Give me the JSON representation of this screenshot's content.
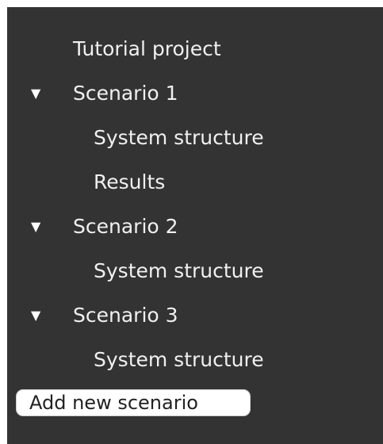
{
  "project": {
    "label": "Tutorial project"
  },
  "scenarios": [
    {
      "label": "Scenario 1",
      "toggle_icon": "▼",
      "children": [
        "System structure",
        "Results"
      ]
    },
    {
      "label": "Scenario 2",
      "toggle_icon": "▼",
      "children": [
        "System structure"
      ]
    },
    {
      "label": "Scenario 3",
      "toggle_icon": "▼",
      "children": [
        "System structure"
      ]
    }
  ],
  "add_button": {
    "label": "Add new scenario"
  },
  "colors": {
    "panel_background": "#333333",
    "text": "#f0f0f0",
    "button_background": "#ffffff",
    "button_text": "#222222"
  }
}
